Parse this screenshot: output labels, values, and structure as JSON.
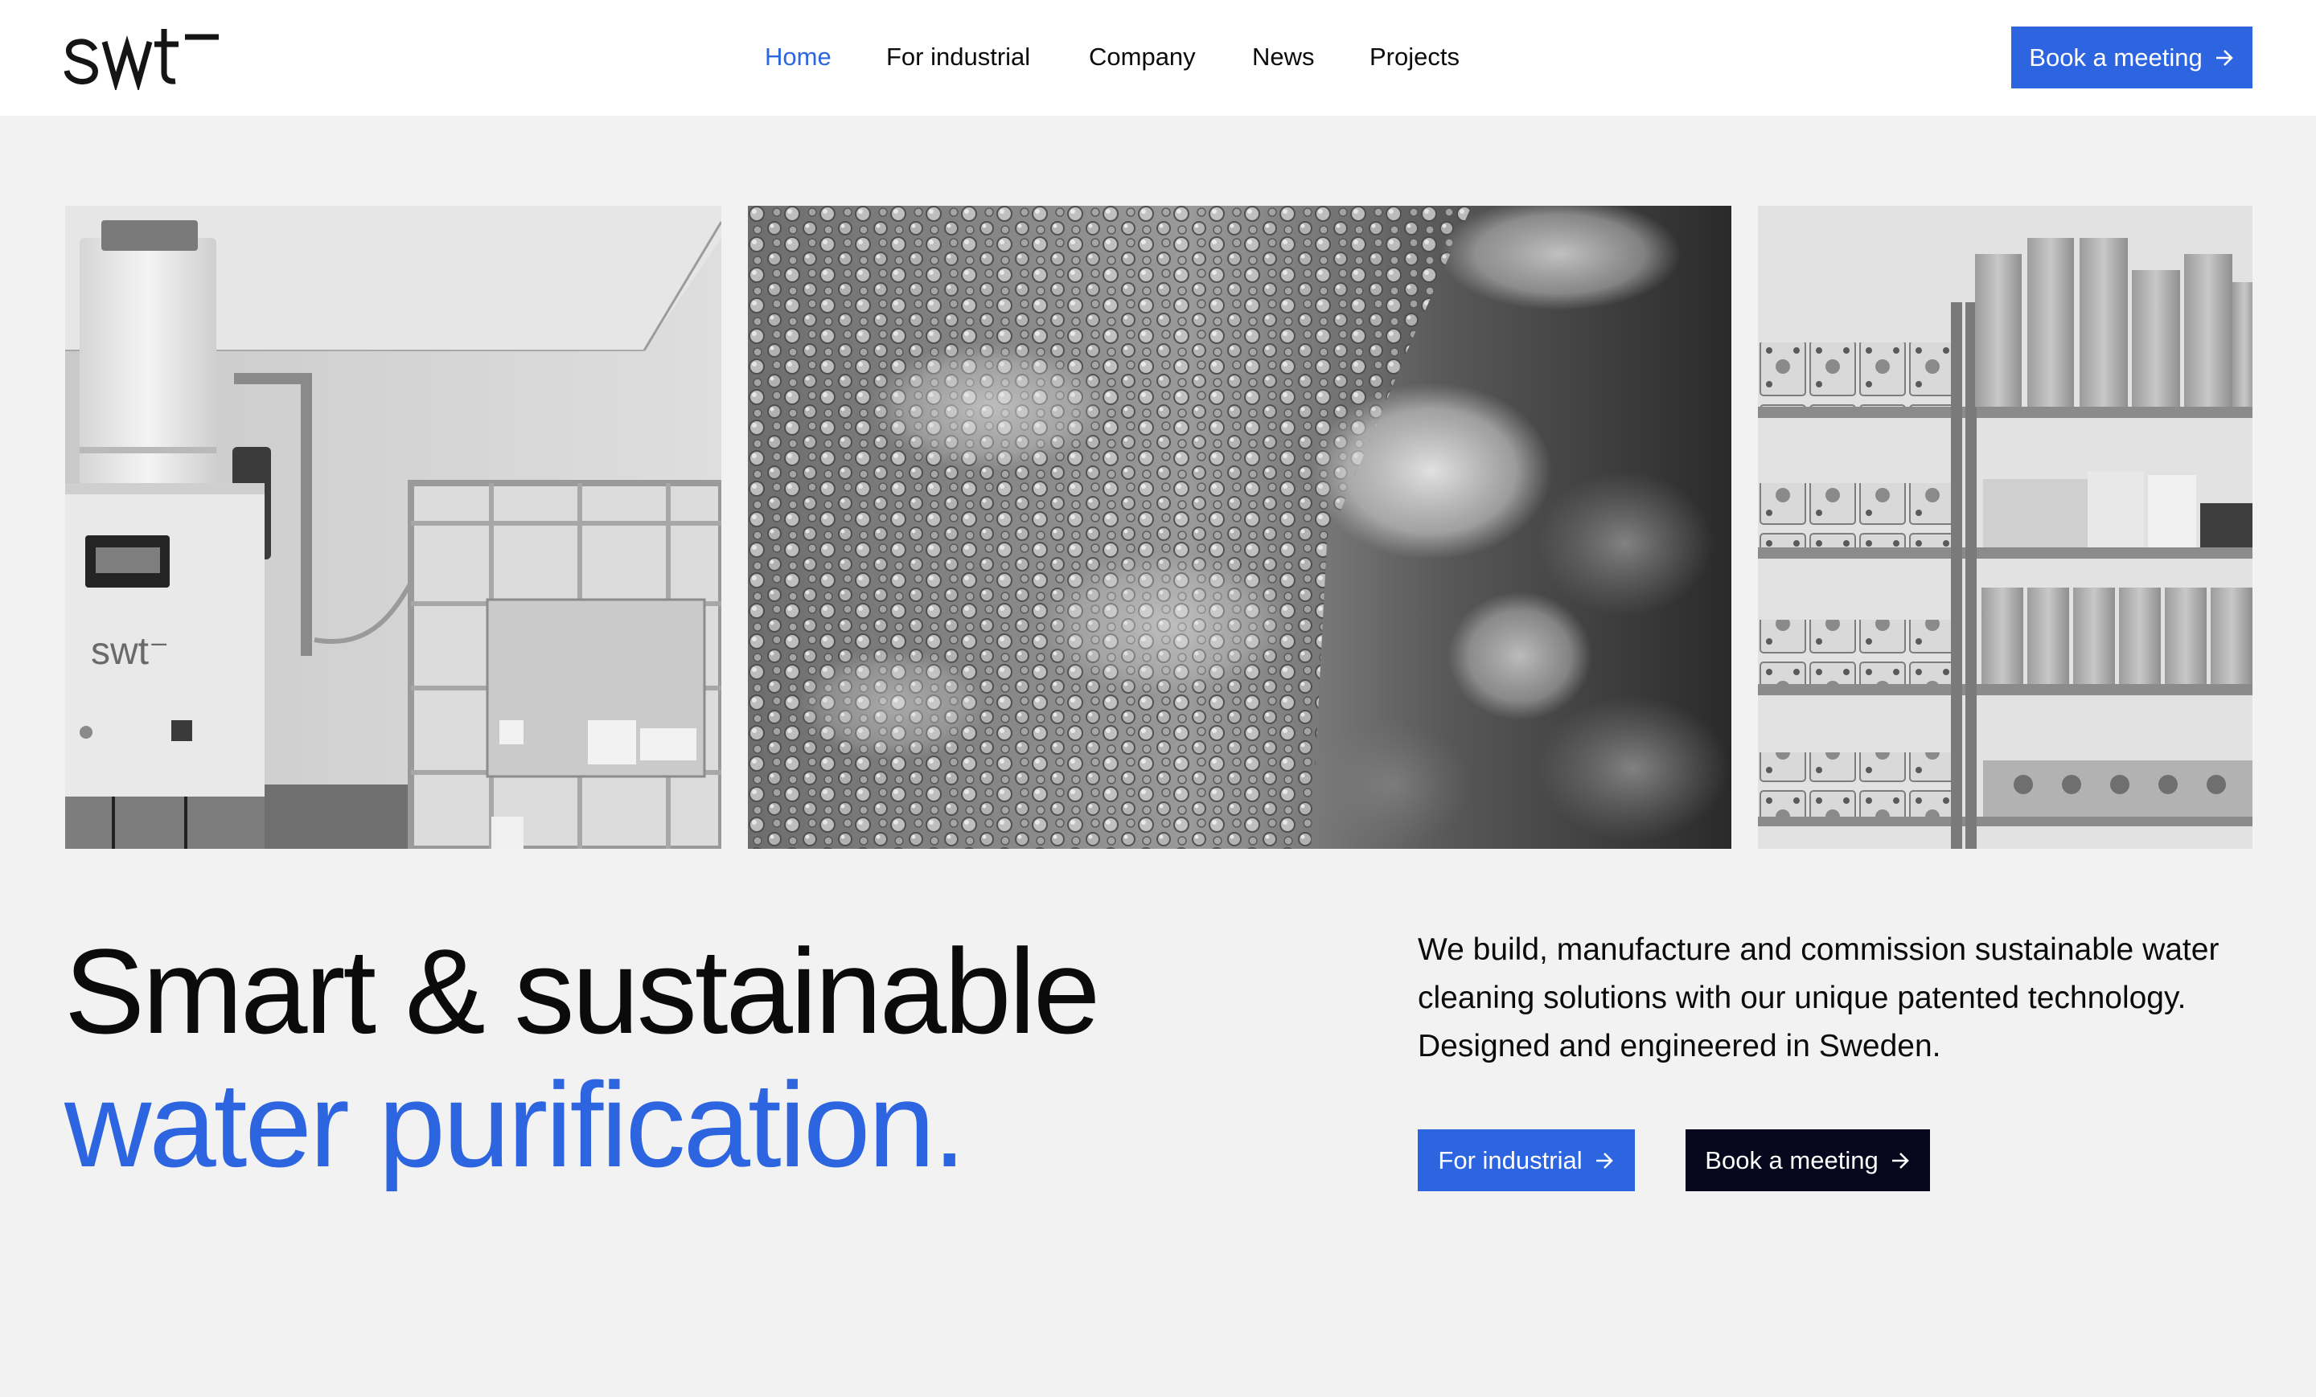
{
  "brand": {
    "logo_text": "swt",
    "accent_color": "#2d64e0",
    "dark_color": "#06061c",
    "background_color": "#f2f2f2"
  },
  "nav": {
    "items": [
      {
        "label": "Home",
        "active": true
      },
      {
        "label": "For industrial",
        "active": false
      },
      {
        "label": "Company",
        "active": false
      },
      {
        "label": "News",
        "active": false
      },
      {
        "label": "Projects",
        "active": false
      }
    ],
    "cta_label": "Book a meeting",
    "cta_icon": "arrow-right-icon"
  },
  "gallery": {
    "images": [
      {
        "subject": "water purification unit and IBC tank",
        "label_text": "swt"
      },
      {
        "subject": "bubbles in water"
      },
      {
        "subject": "warehouse shelves with components"
      }
    ]
  },
  "hero": {
    "headline_line1": "Smart & sustainable",
    "headline_line2": "water purification.",
    "intro": "We build, manufacture and commission sustainable water cleaning solutions with our unique patented technology. Designed and engineered in Sweden.",
    "primary_cta": "For industrial",
    "secondary_cta": "Book a meeting"
  }
}
